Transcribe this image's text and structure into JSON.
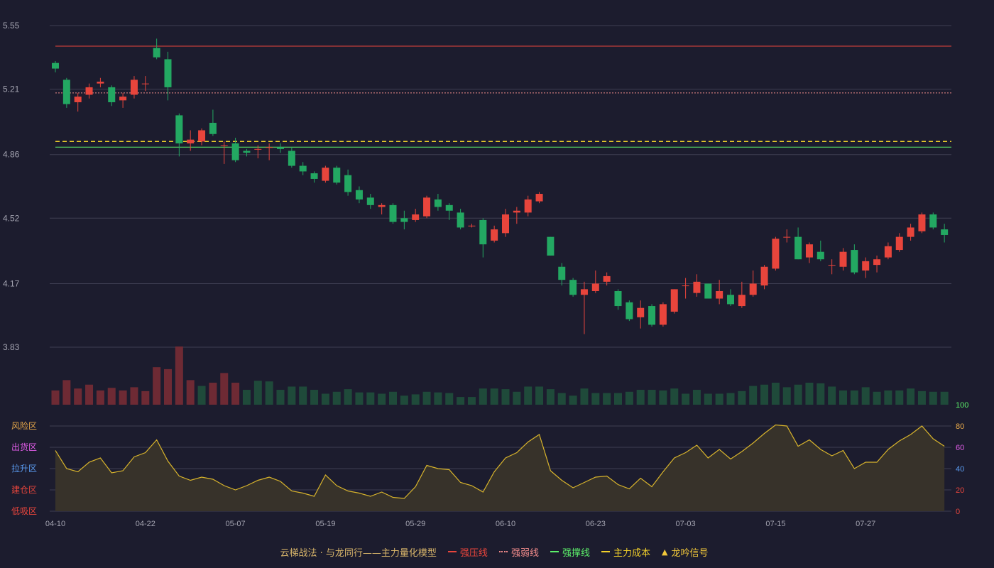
{
  "legend": {
    "title": "云梯战法 · 与龙同行——主力量化模型",
    "items": [
      {
        "label": "强压线",
        "color": "#e8453c",
        "style": "solid"
      },
      {
        "label": "强弱线",
        "color": "#f08a8a",
        "style": "dotted"
      },
      {
        "label": "强撑线",
        "color": "#5cf06a",
        "style": "solid"
      },
      {
        "label": "主力成本",
        "color": "#f2d02a",
        "style": "dashed"
      },
      {
        "label": "龙吟信号",
        "color": "#f2c83a",
        "style": "triangle"
      }
    ]
  },
  "colors": {
    "up": "#e8453c",
    "down": "#23a862",
    "up_vol": "#6e2a34",
    "down_vol": "#1f4a3a",
    "grid": "#3e3e52",
    "axis_text": "#a3a3b0",
    "osc_line": "#d8b42c",
    "osc_fill": "#37322a"
  },
  "chart_data": [
    {
      "type": "candlestick",
      "y_ticks": [
        "5.55",
        "5.21",
        "4.86",
        "4.52",
        "4.17",
        "3.83"
      ],
      "ylim": [
        3.83,
        5.55
      ],
      "x_ticks": [
        "04-10",
        "04-22",
        "05-07",
        "05-19",
        "05-29",
        "06-10",
        "06-23",
        "07-03",
        "07-15",
        "07-27"
      ],
      "x_tick_index": [
        0,
        8,
        16,
        24,
        32,
        40,
        48,
        56,
        64,
        72
      ],
      "reference_lines": [
        {
          "name": "强压线",
          "value": 5.44,
          "color": "#e8453c",
          "style": "solid"
        },
        {
          "name": "强弱线",
          "value": 5.19,
          "color": "#f08a8a",
          "style": "dotted"
        },
        {
          "name": "主力成本",
          "value": 4.93,
          "color": "#f2d02a",
          "style": "dashed"
        },
        {
          "name": "强撑线",
          "value": 4.9,
          "color": "#5cf06a",
          "style": "solid"
        }
      ],
      "candles": [
        [
          5.35,
          5.32,
          5.36,
          5.3
        ],
        [
          5.26,
          5.13,
          5.27,
          5.11
        ],
        [
          5.14,
          5.17,
          5.19,
          5.09
        ],
        [
          5.18,
          5.22,
          5.24,
          5.16
        ],
        [
          5.24,
          5.25,
          5.27,
          5.22
        ],
        [
          5.22,
          5.14,
          5.23,
          5.12
        ],
        [
          5.15,
          5.17,
          5.19,
          5.11
        ],
        [
          5.18,
          5.26,
          5.28,
          5.16
        ],
        [
          5.24,
          5.24,
          5.28,
          5.2
        ],
        [
          5.43,
          5.38,
          5.48,
          5.37
        ],
        [
          5.37,
          5.22,
          5.41,
          5.15
        ],
        [
          5.07,
          4.92,
          5.08,
          4.85
        ],
        [
          4.92,
          4.94,
          4.99,
          4.88
        ],
        [
          4.93,
          4.99,
          5.0,
          4.91
        ],
        [
          5.03,
          4.97,
          5.1,
          4.96
        ],
        [
          4.91,
          4.91,
          4.93,
          4.81
        ],
        [
          4.92,
          4.83,
          4.95,
          4.82
        ],
        [
          4.88,
          4.87,
          4.89,
          4.85
        ],
        [
          4.89,
          4.89,
          4.91,
          4.84
        ],
        [
          4.9,
          4.9,
          4.92,
          4.83
        ],
        [
          4.9,
          4.89,
          4.92,
          4.87
        ],
        [
          4.88,
          4.8,
          4.9,
          4.79
        ],
        [
          4.8,
          4.77,
          4.82,
          4.75
        ],
        [
          4.76,
          4.73,
          4.77,
          4.71
        ],
        [
          4.72,
          4.79,
          4.8,
          4.71
        ],
        [
          4.79,
          4.71,
          4.8,
          4.7
        ],
        [
          4.75,
          4.66,
          4.78,
          4.64
        ],
        [
          4.67,
          4.62,
          4.69,
          4.6
        ],
        [
          4.63,
          4.59,
          4.65,
          4.57
        ],
        [
          4.58,
          4.59,
          4.6,
          4.54
        ],
        [
          4.59,
          4.5,
          4.6,
          4.49
        ],
        [
          4.52,
          4.5,
          4.56,
          4.46
        ],
        [
          4.51,
          4.54,
          4.57,
          4.5
        ],
        [
          4.53,
          4.63,
          4.64,
          4.52
        ],
        [
          4.62,
          4.58,
          4.65,
          4.56
        ],
        [
          4.59,
          4.56,
          4.6,
          4.51
        ],
        [
          4.55,
          4.47,
          4.57,
          4.46
        ],
        [
          4.48,
          4.48,
          4.49,
          4.47
        ],
        [
          4.51,
          4.38,
          4.52,
          4.31
        ],
        [
          4.4,
          4.46,
          4.48,
          4.39
        ],
        [
          4.44,
          4.54,
          4.57,
          4.42
        ],
        [
          4.55,
          4.56,
          4.58,
          4.49
        ],
        [
          4.55,
          4.62,
          4.64,
          4.53
        ],
        [
          4.61,
          4.65,
          4.66,
          4.6
        ],
        [
          4.42,
          4.32,
          4.42,
          4.32
        ],
        [
          4.26,
          4.19,
          4.28,
          4.16
        ],
        [
          4.19,
          4.11,
          4.2,
          4.1
        ],
        [
          4.11,
          4.14,
          4.18,
          3.9
        ],
        [
          4.13,
          4.17,
          4.24,
          4.12
        ],
        [
          4.18,
          4.21,
          4.23,
          4.16
        ],
        [
          4.13,
          4.05,
          4.14,
          4.03
        ],
        [
          4.07,
          3.98,
          4.08,
          3.97
        ],
        [
          3.99,
          4.04,
          4.08,
          3.93
        ],
        [
          4.05,
          3.95,
          4.06,
          3.94
        ],
        [
          3.95,
          4.06,
          4.07,
          3.94
        ],
        [
          4.02,
          4.14,
          4.14,
          4.01
        ],
        [
          4.16,
          4.16,
          4.2,
          4.09
        ],
        [
          4.12,
          4.18,
          4.22,
          4.1
        ],
        [
          4.17,
          4.09,
          4.17,
          4.09
        ],
        [
          4.09,
          4.13,
          4.19,
          4.06
        ],
        [
          4.11,
          4.06,
          4.14,
          4.05
        ],
        [
          4.05,
          4.11,
          4.18,
          4.04
        ],
        [
          4.11,
          4.17,
          4.24,
          4.1
        ],
        [
          4.16,
          4.26,
          4.27,
          4.14
        ],
        [
          4.25,
          4.41,
          4.42,
          4.24
        ],
        [
          4.42,
          4.42,
          4.46,
          4.39
        ],
        [
          4.42,
          4.3,
          4.47,
          4.3
        ],
        [
          4.31,
          4.38,
          4.39,
          4.28
        ],
        [
          4.34,
          4.3,
          4.4,
          4.29
        ],
        [
          4.27,
          4.27,
          4.3,
          4.22
        ],
        [
          4.26,
          4.34,
          4.36,
          4.24
        ],
        [
          4.35,
          4.23,
          4.38,
          4.22
        ],
        [
          4.24,
          4.29,
          4.31,
          4.2
        ],
        [
          4.27,
          4.3,
          4.32,
          4.23
        ],
        [
          4.31,
          4.37,
          4.39,
          4.3
        ],
        [
          4.35,
          4.42,
          4.44,
          4.34
        ],
        [
          4.42,
          4.47,
          4.49,
          4.4
        ],
        [
          4.45,
          4.54,
          4.55,
          4.44
        ],
        [
          4.54,
          4.47,
          4.55,
          4.46
        ],
        [
          4.46,
          4.43,
          4.49,
          4.39
        ]
      ]
    },
    {
      "type": "bar",
      "name_note": "volume",
      "values": [
        22,
        38,
        25,
        31,
        22,
        26,
        22,
        27,
        21,
        58,
        55,
        90,
        38,
        29,
        34,
        49,
        34,
        23,
        37,
        36,
        23,
        28,
        28,
        23,
        17,
        20,
        24,
        19,
        19,
        17,
        20,
        14,
        16,
        20,
        19,
        18,
        12,
        12,
        25,
        25,
        24,
        20,
        28,
        28,
        24,
        18,
        14,
        25,
        18,
        18,
        18,
        20,
        23,
        23,
        22,
        25,
        17,
        23,
        17,
        17,
        18,
        21,
        29,
        31,
        34,
        27,
        31,
        34,
        33,
        28,
        22,
        22,
        27,
        20,
        22,
        22,
        25,
        21,
        20,
        20
      ],
      "up": [
        true,
        true,
        true,
        true,
        true,
        true,
        true,
        true,
        true,
        true,
        true,
        true,
        true,
        false,
        true,
        true,
        true,
        false,
        false,
        false,
        false,
        false,
        false,
        false,
        false,
        false,
        false,
        false,
        false,
        false,
        false,
        false,
        false,
        false,
        false,
        false,
        false,
        false,
        false,
        false,
        false,
        false,
        false,
        false,
        false,
        false,
        false,
        false,
        false,
        false,
        false,
        false,
        false,
        false,
        false,
        false,
        false,
        false,
        false,
        false,
        false,
        false,
        false,
        false,
        false,
        false,
        false,
        false,
        false,
        false,
        false,
        false,
        false,
        false,
        false,
        false,
        false,
        false,
        false,
        false
      ],
      "ylim": [
        0,
        90
      ]
    },
    {
      "type": "area",
      "values": [
        57,
        40,
        37,
        46,
        50,
        36,
        38,
        51,
        55,
        67,
        47,
        33,
        29,
        32,
        30,
        24,
        20,
        24,
        29,
        32,
        28,
        19,
        17,
        14,
        34,
        24,
        19,
        17,
        14,
        18,
        13,
        12,
        23,
        43,
        40,
        39,
        27,
        24,
        18,
        37,
        50,
        55,
        65,
        72,
        38,
        29,
        22,
        27,
        32,
        33,
        25,
        21,
        31,
        23,
        37,
        50,
        55,
        62,
        50,
        58,
        49,
        56,
        64,
        73,
        81,
        80,
        61,
        67,
        58,
        52,
        57,
        40,
        46,
        46,
        58,
        66,
        72,
        80,
        68,
        61
      ],
      "ylim": [
        0,
        100
      ],
      "right_ticks": [
        {
          "value": 100,
          "label": "100",
          "color": "#5cf06a"
        },
        {
          "value": 80,
          "label": "80",
          "color": "#e8a94a"
        },
        {
          "value": 60,
          "label": "60",
          "color": "#e05ce8"
        },
        {
          "value": 40,
          "label": "40",
          "color": "#5a9bf0"
        },
        {
          "value": 20,
          "label": "20",
          "color": "#e8453c"
        },
        {
          "value": 0,
          "label": "0",
          "color": "#e8453c"
        }
      ],
      "zones": [
        {
          "value": 80,
          "label": "风险区",
          "color": "#e8a94a"
        },
        {
          "value": 60,
          "label": "出货区",
          "color": "#e05ce8"
        },
        {
          "value": 40,
          "label": "拉升区",
          "color": "#5a9bf0"
        },
        {
          "value": 20,
          "label": "建仓区",
          "color": "#e8453c"
        },
        {
          "value": 0,
          "label": "低吸区",
          "color": "#e8453c"
        }
      ]
    }
  ]
}
